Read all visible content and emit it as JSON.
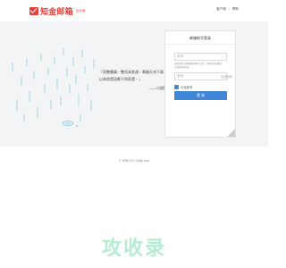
{
  "header": {
    "logo_text": "知金邮箱",
    "logo_sub": "企业版",
    "links": [
      "客户端",
      "帮助"
    ]
  },
  "quote": {
    "text": "「雨整畫霧・整氏具其達・華穢天充下兩・以為崇是因晚下與家還・」",
    "author": "——小說築"
  },
  "login": {
    "title": "邮箱帐号登录",
    "account_placeholder": "帐号",
    "hint_line1": "请使用企业邮箱的域名登录，或联系管理员",
    "hint_line2": "开通相关权限",
    "password_placeholder": "密码",
    "forgot": "忘记密码",
    "remember": "记住帐号",
    "button": "登 录"
  },
  "footer": {
    "copyright": "© 1998-2017 Zhijin.com"
  },
  "watermark": "攻收录",
  "colors": {
    "brand": "#e8403a",
    "accent": "#3f87d6",
    "banner_bg": "#f3f4f5",
    "watermark": "#b6ecd0"
  }
}
